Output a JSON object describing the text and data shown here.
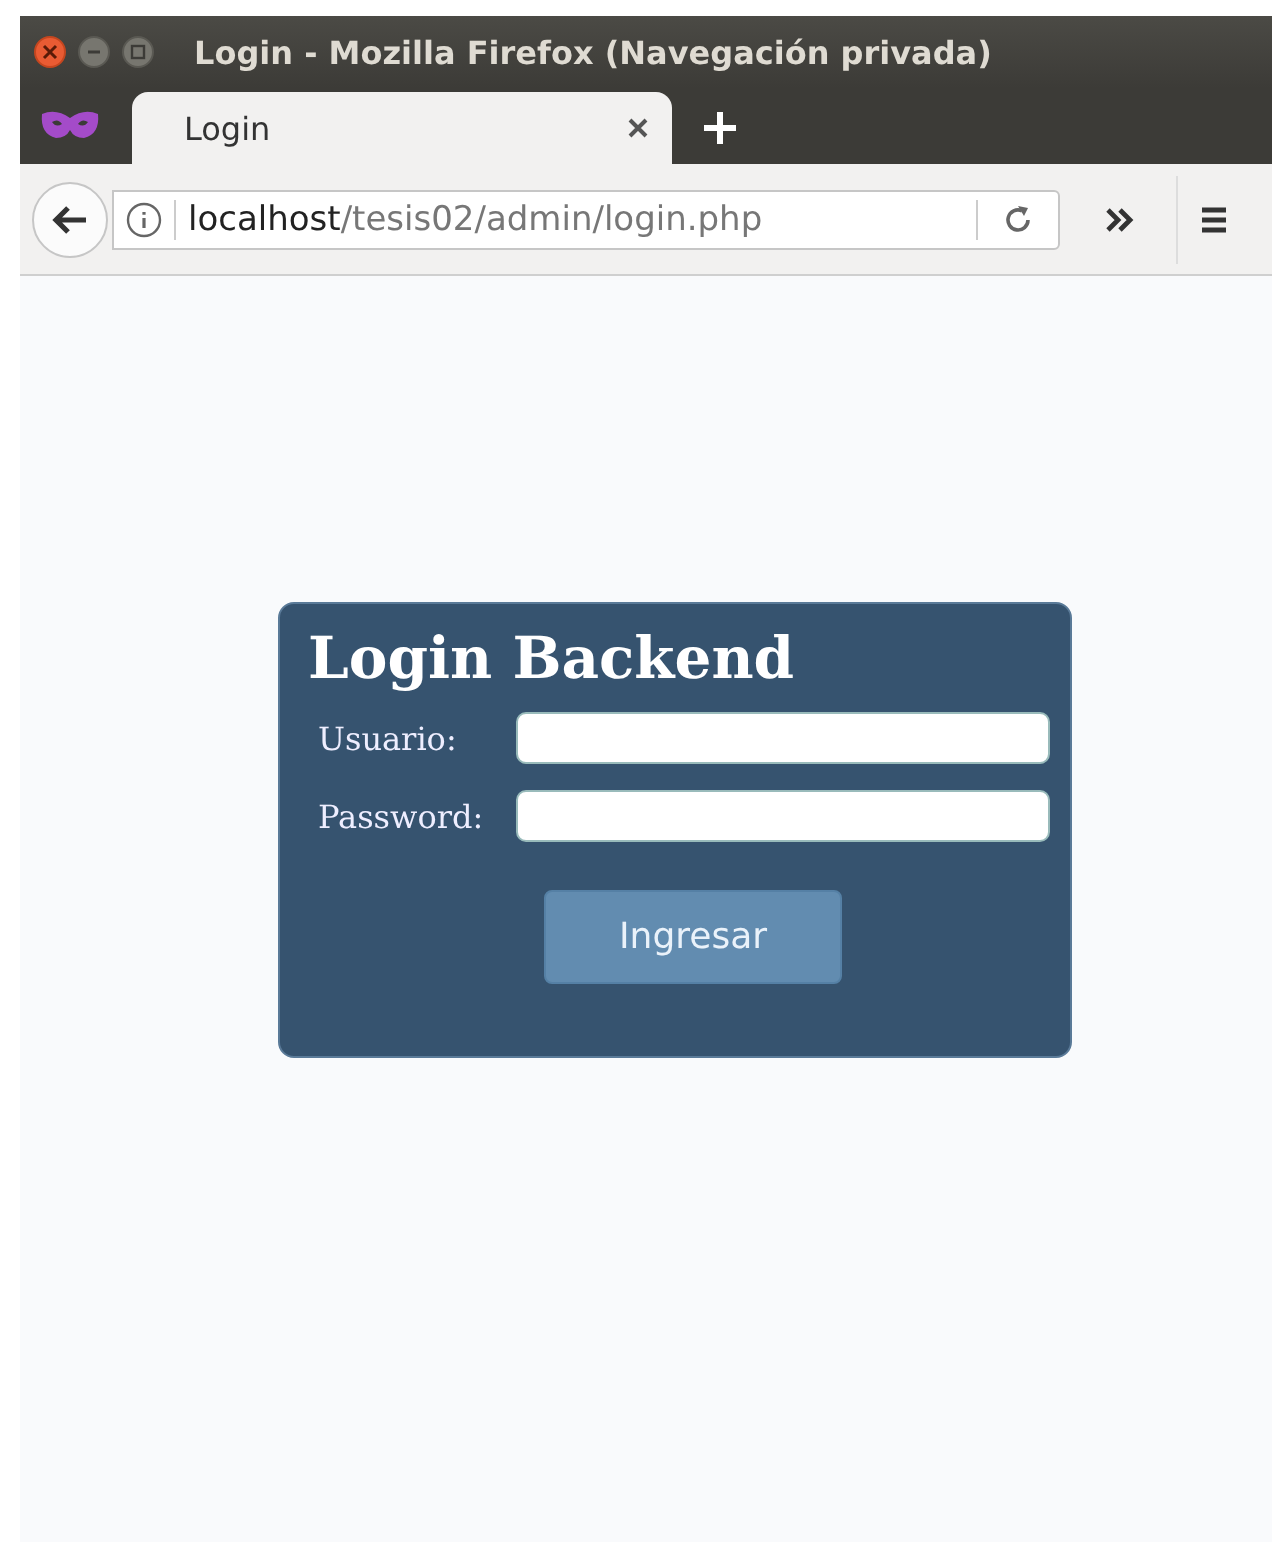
{
  "window": {
    "title": "Login - Mozilla Firefox (Navegación privada)"
  },
  "tabs": [
    {
      "label": "Login",
      "selected": true
    }
  ],
  "address_bar": {
    "host": "localhost",
    "path": "/tesis02/admin/login.php"
  },
  "login_form": {
    "title": "Login Backend",
    "fields": [
      {
        "label": "Usuario:"
      },
      {
        "label": "Password:"
      }
    ],
    "button": "Ingresar"
  }
}
